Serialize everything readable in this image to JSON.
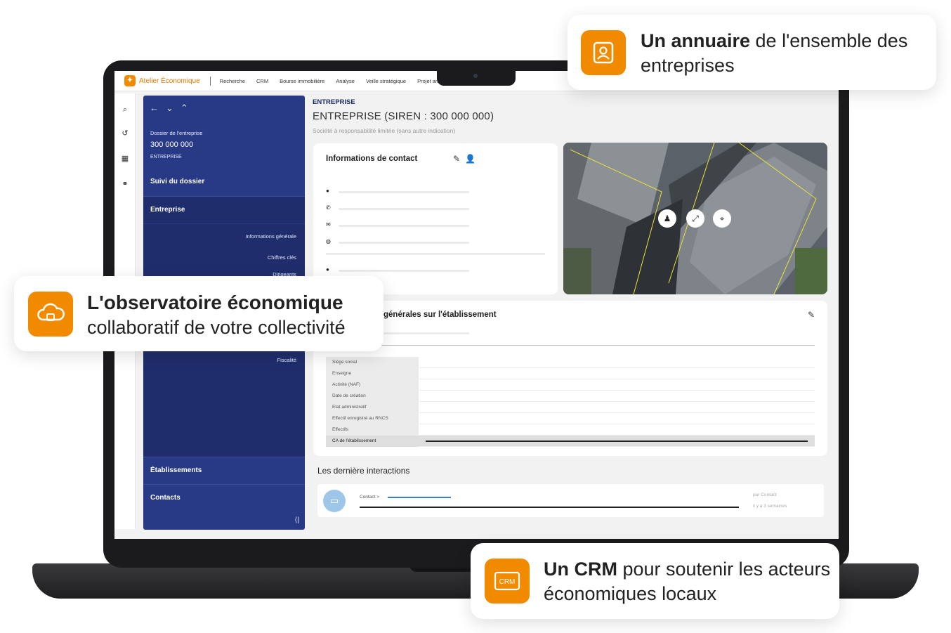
{
  "topnav": {
    "logo_text": "Atelier Économique",
    "items": [
      "Recherche",
      "CRM",
      "Bourse immobilière",
      "Analyse",
      "Veille stratégique",
      "Projet amé"
    ]
  },
  "sidebar": {
    "caption": "Dossier de l'entreprise",
    "siren": "300 000 000",
    "type": "ENTREPRISE",
    "sections": {
      "suivi": "Suivi du dossier",
      "entreprise": "Entreprise",
      "etablissements": "Établissements",
      "contacts": "Contacts"
    },
    "subitems": {
      "info": "Informations générale",
      "chiffres": "Chiffres clés",
      "dirigeants": "Dirigeants",
      "fiscalite": "Fiscalité"
    }
  },
  "main": {
    "label": "ENTREPRISE",
    "title": "ENTREPRISE (SIREN : 300 000 000)",
    "subtitle": "Société à responsabilité limitée (sans autre indication)"
  },
  "contact_card": {
    "title": "Informations de contact"
  },
  "info_card": {
    "title": "générales sur l'établissement",
    "rows": [
      "Siège social",
      "Enseigne",
      "Activité (NAF)",
      "Date de création",
      "Etat administratif",
      "Effectif enregistré au RNCS",
      "Effectifs",
      "CA de l'établissement"
    ]
  },
  "interactions": {
    "title": "Les dernière interactions",
    "contact_link": "Contact >",
    "by": "par Contact",
    "when": "il y a 3 semaines"
  },
  "callouts": {
    "annuaire_strong": "Un annuaire",
    "annuaire_rest": " de l'ensemble des entreprises",
    "observatoire_strong": "L'observatoire économique",
    "observatoire_rest": "collaboratif de votre collectivité",
    "crm_strong": "Un CRM",
    "crm_rest": " pour soutenir les acteurs économiques locaux",
    "crm_badge": "CRM"
  },
  "colors": {
    "accent": "#f28a00",
    "sidebar_blue": "#283a86",
    "sidebar_dark": "#1f2d6c"
  }
}
